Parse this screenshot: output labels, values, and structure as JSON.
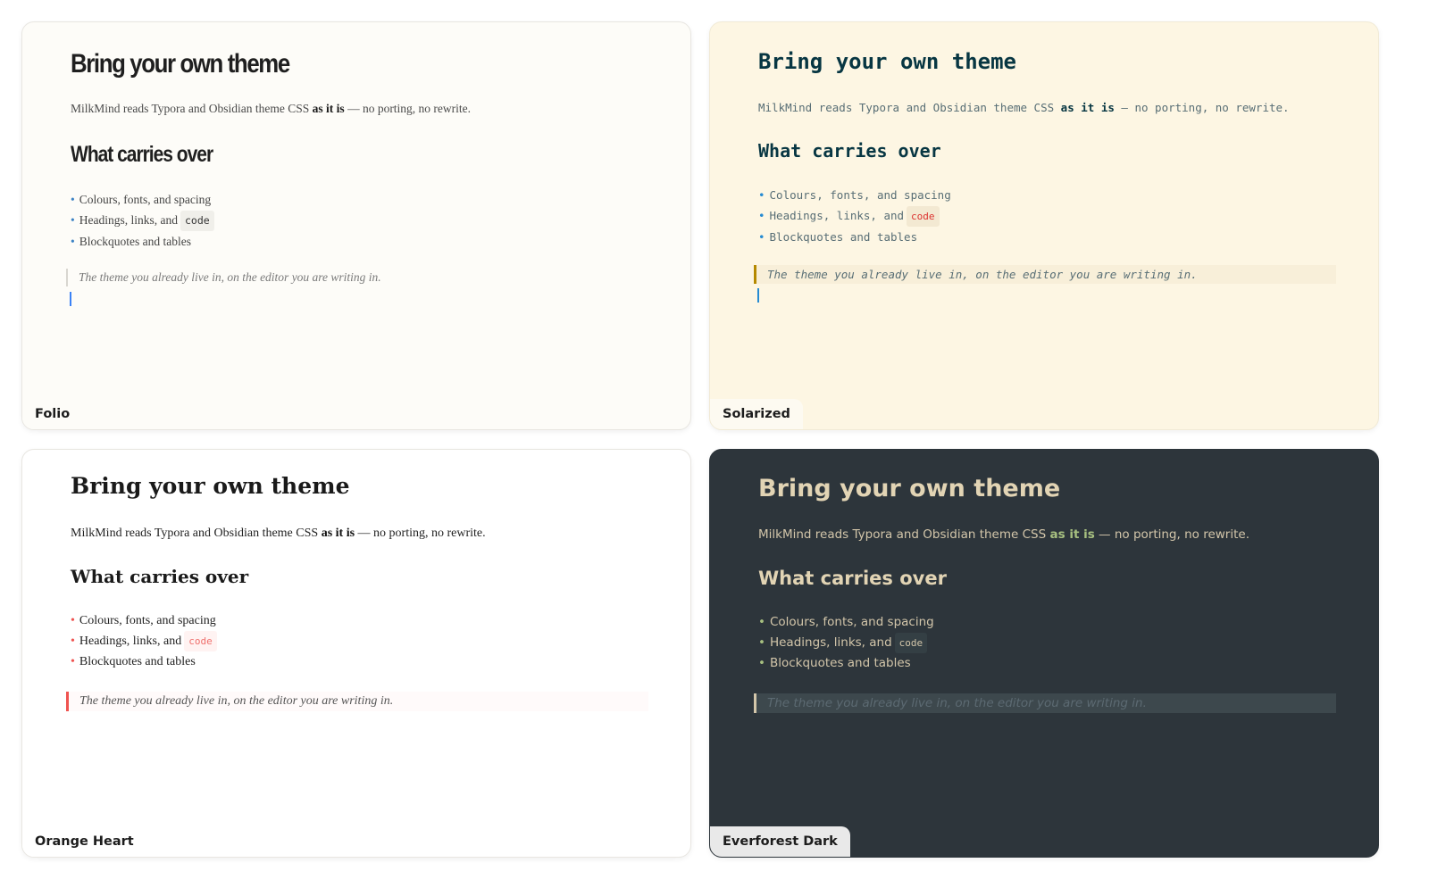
{
  "themes": [
    {
      "name": "Folio",
      "heading": "Bring your own theme",
      "intro": "MilkMind reads Typora and Obsidian theme CSS",
      "intro_bold": "as it is",
      "intro_end": " — no porting, no rewrite.",
      "subheading": "What carries over",
      "bullet": "•",
      "items": [
        "Colours, fonts, and spacing",
        "Headings, links, and",
        "Blockquotes and tables"
      ],
      "code": "code",
      "quote": "The theme you already live in, on the editor you are writing in."
    },
    {
      "name": "Solarized",
      "heading": "Bring your own theme",
      "intro": "MilkMind reads Typora and Obsidian theme CSS",
      "intro_bold": "as it is",
      "intro_end": " – no porting, no rewrite.",
      "subheading": "What carries over",
      "bullet": "•",
      "items": [
        "Colours, fonts, and spacing",
        "Headings, links, and",
        "Blockquotes and tables"
      ],
      "code": "code",
      "quote": "The theme you already live in, on the editor you are writing in."
    },
    {
      "name": "Orange Heart",
      "heading": "Bring your own theme",
      "intro": "MilkMind reads Typora and Obsidian theme CSS",
      "intro_bold": "as it is",
      "intro_end": " — no porting, no rewrite.",
      "subheading": "What carries over",
      "bullet": "•",
      "items": [
        "Colours, fonts, and spacing",
        "Headings, links, and",
        "Blockquotes and tables"
      ],
      "code": "code",
      "quote": "The theme you already live in, on the editor you are writing in."
    },
    {
      "name": "Everforest Dark",
      "heading": "Bring your own theme",
      "intro": "MilkMind reads Typora and Obsidian theme CSS",
      "intro_bold": "as it is",
      "intro_end": " — no porting, no rewrite.",
      "subheading": "What carries over",
      "bullet": "•",
      "items": [
        "Colours, fonts, and spacing",
        "Headings, links, and",
        "Blockquotes and tables"
      ],
      "code": "code",
      "quote": "The theme you already live in, on the editor you are writing in."
    }
  ],
  "colors": {
    "folio_bg": "#fdfcf8",
    "solarized_bg": "#fdf6e3",
    "orange_heart_bg": "#ffffff",
    "everforest_bg": "#2d353b",
    "folio_accent": "#3b82c4",
    "solarized_accent": "#268bd2",
    "orange_heart_accent": "#ef5350",
    "everforest_accent": "#a7c080"
  }
}
